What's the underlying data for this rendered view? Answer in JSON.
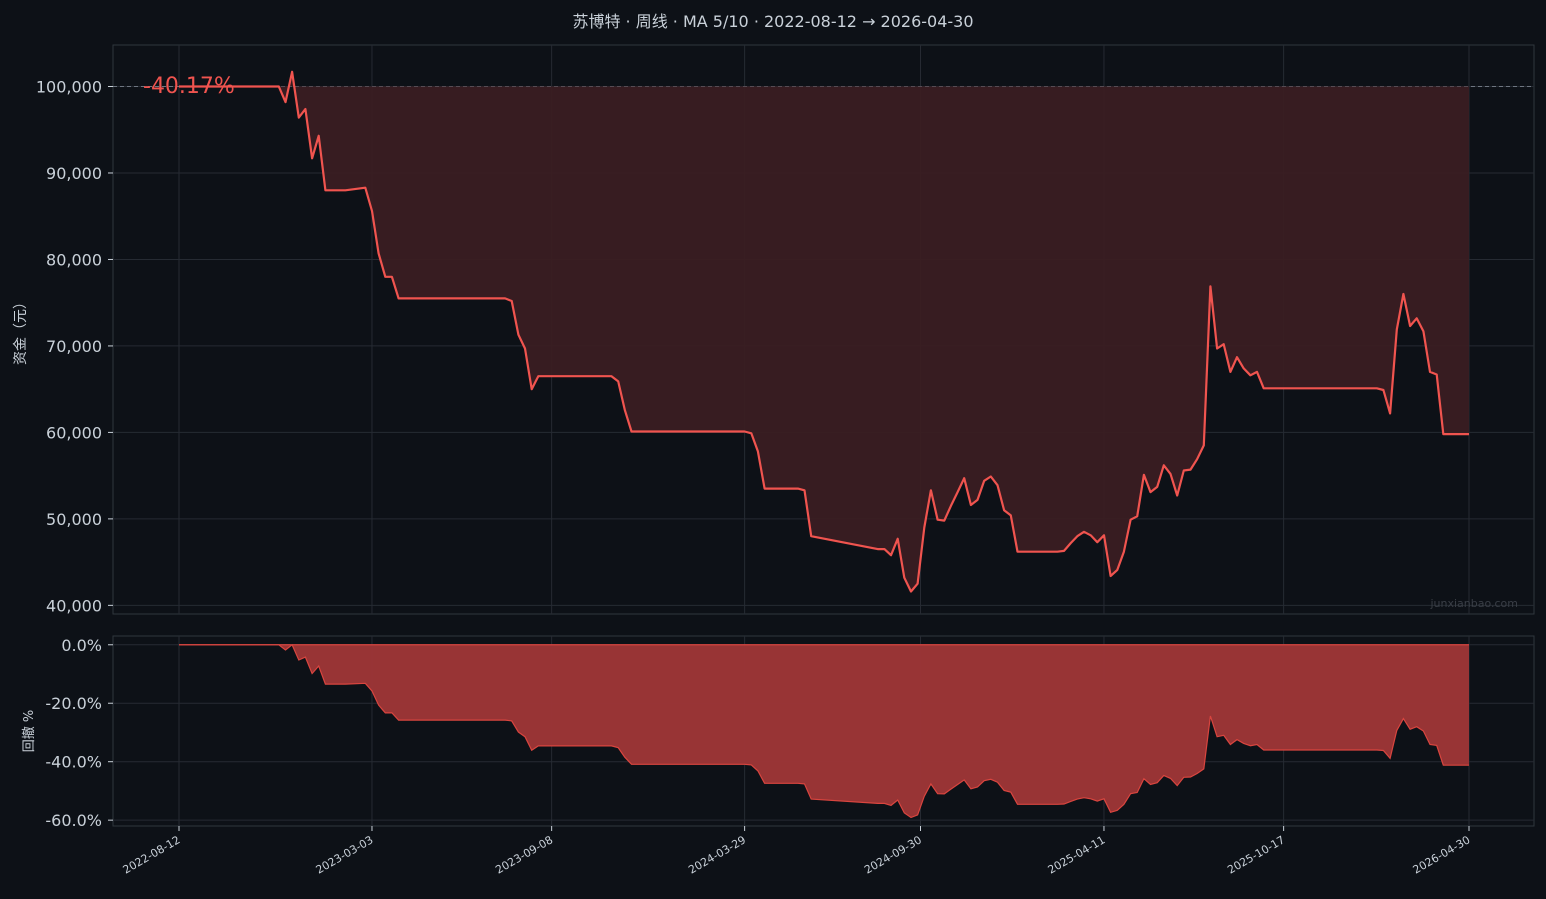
{
  "title": "苏博特 · 周线 · MA 5/10 · 2022-08-12 → 2026-04-30",
  "colors": {
    "background": "#0d1117",
    "panel": "#0d1117",
    "grid": "#262b33",
    "axis_text": "#c9d1d9",
    "line": "#f0544f",
    "fill_top": "#3a1e22",
    "fill_bottom": "#9b3536",
    "baseline": "#6e7681",
    "watermark": "#3a3f47"
  },
  "return_label": "-40.17%",
  "watermark": "junxianbao.com",
  "chart_data": [
    {
      "type": "area",
      "name": "equity",
      "ylabel": "资金（元）",
      "ylim": [
        39000,
        104800
      ],
      "yticks": [
        40000,
        50000,
        60000,
        70000,
        80000,
        90000,
        100000
      ],
      "ytick_labels": [
        "40,000",
        "50,000",
        "60,000",
        "70,000",
        "80,000",
        "90,000",
        "100,000"
      ],
      "baseline": 100000,
      "grid": true,
      "x": [
        "2022-08-12",
        "2022-09-16",
        "2022-10-21",
        "2022-11-25",
        "2022-12-02",
        "2022-12-09",
        "2022-12-16",
        "2022-12-23",
        "2022-12-30",
        "2023-01-06",
        "2023-01-13",
        "2023-01-20",
        "2023-02-03",
        "2023-02-24",
        "2023-03-03",
        "2023-03-10",
        "2023-03-17",
        "2023-03-24",
        "2023-03-31",
        "2023-04-07",
        "2023-04-14",
        "2023-07-21",
        "2023-07-28",
        "2023-08-04",
        "2023-08-11",
        "2023-08-18",
        "2023-08-25",
        "2023-09-01",
        "2023-11-03",
        "2023-11-10",
        "2023-11-17",
        "2023-11-24",
        "2023-12-01",
        "2024-03-29",
        "2024-04-05",
        "2024-04-12",
        "2024-04-19",
        "2024-05-24",
        "2024-05-31",
        "2024-06-07",
        "2024-08-16",
        "2024-08-23",
        "2024-08-30",
        "2024-09-06",
        "2024-09-13",
        "2024-09-20",
        "2024-09-27",
        "2024-10-04",
        "2024-10-11",
        "2024-10-18",
        "2024-10-25",
        "2024-11-01",
        "2024-11-08",
        "2024-11-15",
        "2024-11-22",
        "2024-11-29",
        "2024-12-06",
        "2024-12-13",
        "2024-12-20",
        "2024-12-27",
        "2025-01-03",
        "2025-01-10",
        "2025-02-21",
        "2025-02-28",
        "2025-03-07",
        "2025-03-14",
        "2025-03-21",
        "2025-03-28",
        "2025-04-04",
        "2025-04-11",
        "2025-04-18",
        "2025-04-25",
        "2025-05-02",
        "2025-05-09",
        "2025-05-16",
        "2025-05-23",
        "2025-05-30",
        "2025-06-06",
        "2025-06-13",
        "2025-06-20",
        "2025-06-27",
        "2025-07-04",
        "2025-07-11",
        "2025-07-18",
        "2025-07-25",
        "2025-08-01",
        "2025-08-08",
        "2025-08-15",
        "2025-08-22",
        "2025-08-29",
        "2025-09-05",
        "2025-09-12",
        "2025-09-19",
        "2025-09-26",
        "2025-10-03",
        "2026-01-23",
        "2026-01-30",
        "2026-02-06",
        "2026-02-13",
        "2026-02-20",
        "2026-02-27",
        "2026-03-06",
        "2026-03-13",
        "2026-03-20",
        "2026-03-27",
        "2026-04-03",
        "2026-04-30"
      ],
      "values": [
        100000,
        100000,
        100000,
        100000,
        98200,
        101700,
        96400,
        97400,
        91700,
        94300,
        88000,
        88000,
        88000,
        88300,
        85600,
        80700,
        78000,
        78000,
        75500,
        75500,
        75500,
        75500,
        75200,
        71300,
        69700,
        65000,
        66500,
        66500,
        66500,
        66500,
        65900,
        62600,
        60100,
        60100,
        59900,
        57800,
        53500,
        53500,
        53300,
        48000,
        46500,
        46500,
        45800,
        47700,
        43200,
        41600,
        42500,
        49000,
        53300,
        49900,
        49800,
        51500,
        53100,
        54700,
        51600,
        52200,
        54400,
        54900,
        53900,
        51000,
        50400,
        46200,
        46200,
        46300,
        47200,
        48000,
        48500,
        48100,
        47300,
        48100,
        43400,
        44100,
        46200,
        49900,
        50300,
        55100,
        53100,
        53700,
        56200,
        55200,
        52700,
        55600,
        55700,
        56900,
        58500,
        76900,
        69700,
        70200,
        67000,
        68700,
        67400,
        66600,
        67000,
        65100,
        65100,
        65100,
        64900,
        62200,
        71900,
        76000,
        72300,
        73200,
        71700,
        67000,
        66700,
        59800,
        59800
      ]
    },
    {
      "type": "area",
      "name": "drawdown",
      "ylabel": "回撤 %",
      "ylim": [
        -62,
        3
      ],
      "yticks": [
        0,
        -20,
        -40,
        -60
      ],
      "ytick_labels": [
        "0.0%",
        "-20.0%",
        "-40.0%",
        "-60.0%"
      ],
      "grid": true,
      "x_tick_labels": [
        "2022-08-12",
        "2023-03-03",
        "2023-09-08",
        "2024-03-29",
        "2024-09-30",
        "2025-04-11",
        "2025-10-17",
        "2026-04-30"
      ]
    }
  ]
}
